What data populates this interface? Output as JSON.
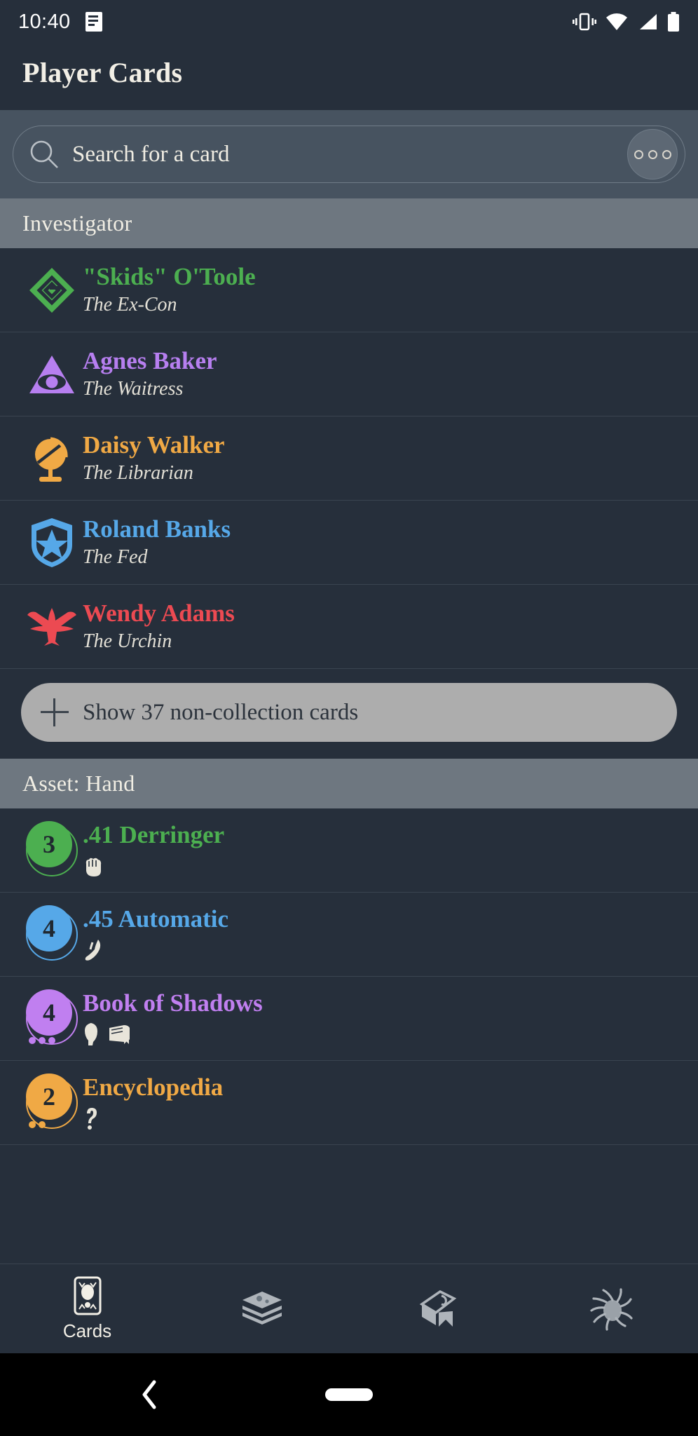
{
  "status_bar": {
    "time": "10:40",
    "icons": [
      "notification-icon",
      "vibrate-icon",
      "wifi-icon",
      "signal-icon",
      "battery-icon"
    ]
  },
  "app": {
    "title": "Player Cards"
  },
  "search": {
    "placeholder": "Search for a card",
    "icon": "search-icon",
    "overflow_icon": "more-options-icon"
  },
  "sections": [
    {
      "header": "Investigator",
      "type": "investigator",
      "items": [
        {
          "name": "\"Skids\" O'Toole",
          "subtitle": "The Ex-Con",
          "color": "#4caf50",
          "icon": "rogue-class-icon"
        },
        {
          "name": "Agnes Baker",
          "subtitle": "The Waitress",
          "color": "#b77ff0",
          "icon": "mystic-class-icon"
        },
        {
          "name": "Daisy Walker",
          "subtitle": "The Librarian",
          "color": "#f0a945",
          "icon": "seeker-class-icon"
        },
        {
          "name": "Roland Banks",
          "subtitle": "The Fed",
          "color": "#56a8e8",
          "icon": "guardian-class-icon"
        },
        {
          "name": "Wendy Adams",
          "subtitle": "The Urchin",
          "color": "#ec4a52",
          "icon": "survivor-class-icon"
        }
      ],
      "show_more": {
        "label": "Show 37 non-collection cards",
        "icon": "plus-icon"
      }
    },
    {
      "header": "Asset: Hand",
      "type": "card",
      "items": [
        {
          "name": ".41 Derringer",
          "cost": "3",
          "color": "#4caf50",
          "uses": 0,
          "skills": [
            "combat-icon"
          ]
        },
        {
          "name": ".45 Automatic",
          "cost": "4",
          "color": "#56a8e8",
          "uses": 0,
          "skills": [
            "agility-icon"
          ]
        },
        {
          "name": "Book of Shadows",
          "cost": "4",
          "color": "#c07ff0",
          "uses": 3,
          "skills": [
            "willpower-icon",
            "intellect-icon"
          ]
        },
        {
          "name": "Encyclopedia",
          "cost": "2",
          "color": "#f0a945",
          "uses": 2,
          "skills": [
            "wild-icon"
          ]
        }
      ]
    }
  ],
  "bottom_nav": [
    {
      "label": "Cards",
      "icon": "card-icon",
      "active": true
    },
    {
      "label": "",
      "icon": "decks-icon",
      "active": false
    },
    {
      "label": "",
      "icon": "campaign-icon",
      "active": false
    },
    {
      "label": "",
      "icon": "elder-sign-icon",
      "active": false
    }
  ],
  "system_nav": {
    "back": "back-chevron-icon",
    "home": "home-pill-icon"
  }
}
